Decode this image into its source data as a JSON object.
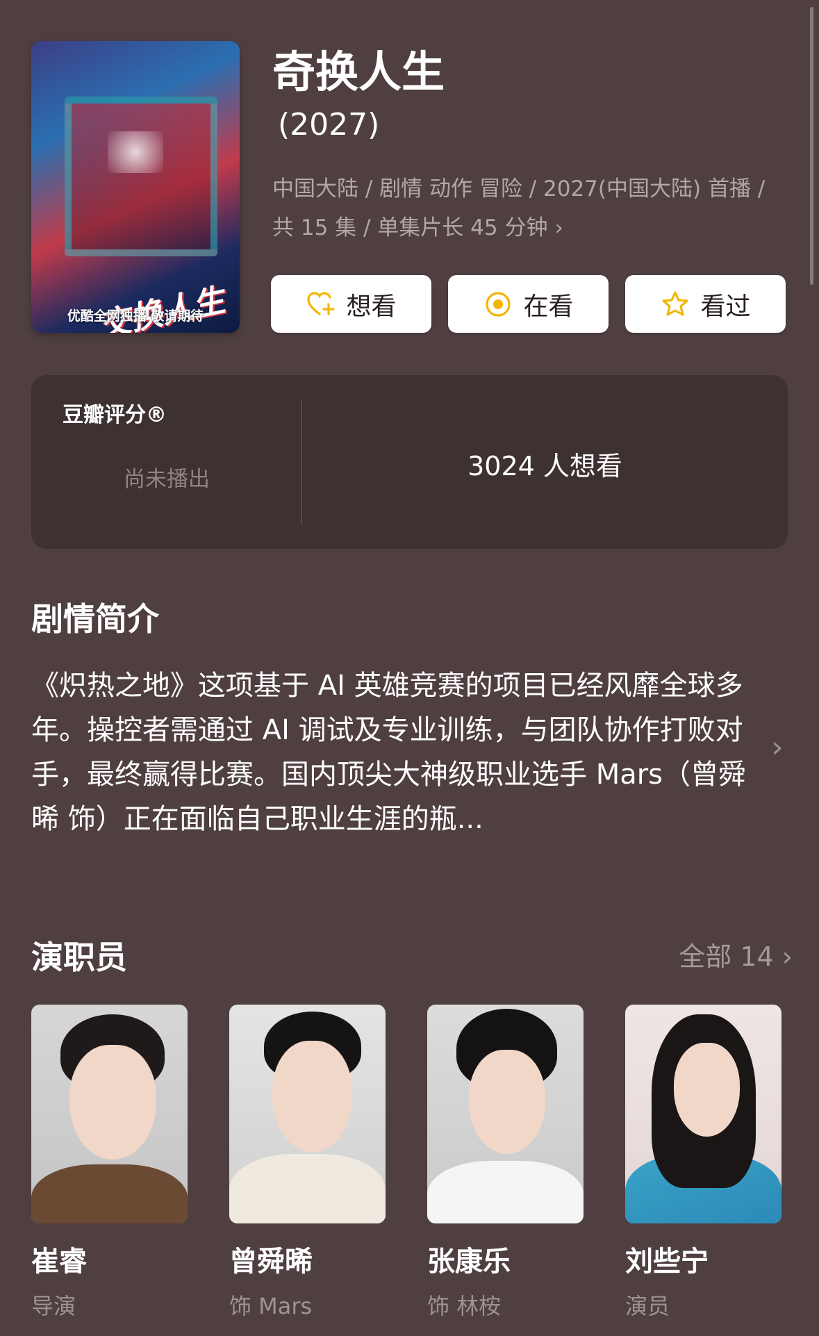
{
  "show": {
    "title": "奇换人生",
    "year": "(2027)",
    "meta_line1": "中国大陆 / 剧情 动作 冒险 / 2027(中国大陆) 首播 /",
    "meta_line2": "共 15 集 / 单集片长 45 分钟",
    "poster_title": "交换人生",
    "poster_tagline": "优酷全网独播 敬请期待"
  },
  "actions": [
    {
      "label": "想看",
      "icon": "heart-plus-icon"
    },
    {
      "label": "在看",
      "icon": "target-icon"
    },
    {
      "label": "看过",
      "icon": "star-icon"
    }
  ],
  "rating": {
    "label": "豆瓣评分®",
    "status": "尚未播出",
    "want_count": "3024 人想看"
  },
  "synopsis": {
    "title": "剧情简介",
    "text": "《炽热之地》这项基于 AI 英雄竞赛的项目已经风靡全球多年。操控者需通过 AI 调试及专业训练，与团队协作打败对手，最终赢得比赛。国内顶尖大神级职业选手 Mars（曾舜晞 饰）正在面临自己职业生涯的瓶..."
  },
  "cast": {
    "title": "演职员",
    "all_label": "全部 14",
    "members": [
      {
        "name": "崔睿",
        "role": "导演"
      },
      {
        "name": "曾舜晞",
        "role": "饰 Mars"
      },
      {
        "name": "张康乐",
        "role": "饰 林桉"
      },
      {
        "name": "刘些宁",
        "role": "演员"
      }
    ]
  },
  "colors": {
    "background": "#4f3f40",
    "card": "#3e3132",
    "accent": "#f2b705"
  }
}
